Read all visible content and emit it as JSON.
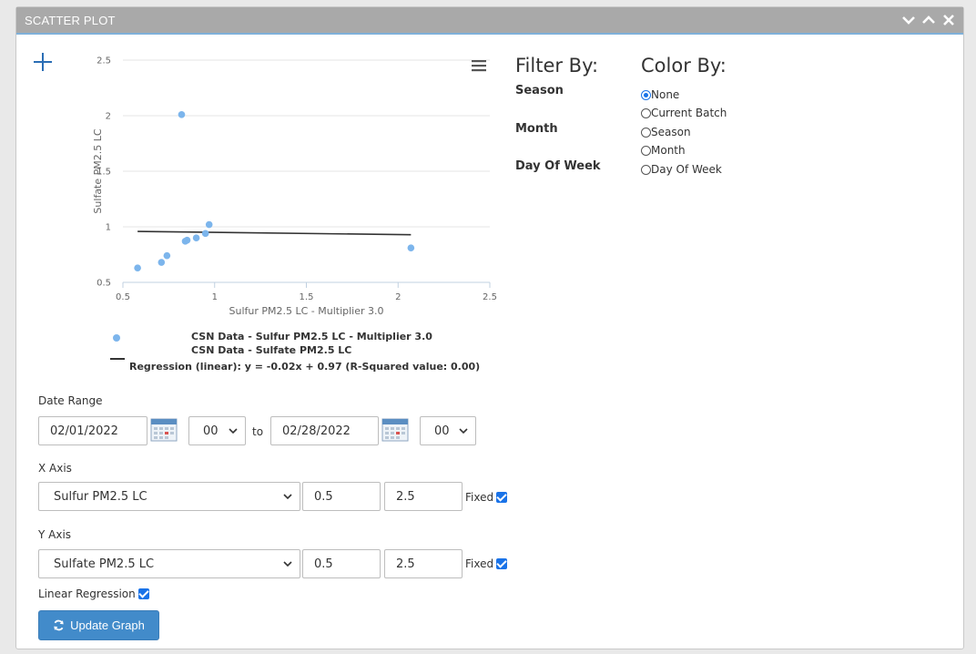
{
  "panel": {
    "title": "SCATTER PLOT"
  },
  "chart_data": {
    "type": "scatter",
    "xlabel": "Sulfur PM2.5 LC - Multiplier 3.0",
    "ylabel": "Sulfate PM2.5 LC",
    "xlim": [
      0.5,
      2.5
    ],
    "ylim": [
      0.5,
      2.5
    ],
    "xticks": [
      "0.5",
      "1",
      "1.5",
      "2",
      "2.5"
    ],
    "yticks": [
      "0.5",
      "1",
      "1.5",
      "2",
      "2.5"
    ],
    "grid": true,
    "series": [
      {
        "name": "CSN Data - Sulfur PM2.5 LC - Multiplier 3.0 / CSN Data - Sulfate PM2.5 LC",
        "color": "#7cb5ec",
        "points": [
          [
            0.58,
            0.63
          ],
          [
            0.71,
            0.68
          ],
          [
            0.74,
            0.74
          ],
          [
            0.82,
            2.01
          ],
          [
            0.84,
            0.87
          ],
          [
            0.85,
            0.88
          ],
          [
            0.9,
            0.9
          ],
          [
            0.95,
            0.94
          ],
          [
            0.97,
            1.02
          ],
          [
            2.07,
            0.81
          ]
        ]
      }
    ],
    "regression": {
      "type": "linear",
      "slope": -0.02,
      "intercept": 0.97,
      "x_range": [
        0.58,
        2.07
      ],
      "color": "#333333"
    },
    "legend": {
      "series_line1": "CSN Data - Sulfur PM2.5 LC - Multiplier 3.0",
      "series_line2": "CSN Data - Sulfate PM2.5 LC",
      "regression_label": "Regression (linear): y = -0.02x + 0.97 (R-Squared value: 0.00)",
      "placement": "bottom"
    }
  },
  "filter": {
    "title": "Filter By:",
    "items": [
      "Season",
      "Month",
      "Day Of Week"
    ]
  },
  "color_by": {
    "title": "Color By:",
    "options": [
      {
        "label": "None",
        "checked": true
      },
      {
        "label": "Current Batch",
        "checked": false
      },
      {
        "label": "Season",
        "checked": false
      },
      {
        "label": "Month",
        "checked": false
      },
      {
        "label": "Day Of Week",
        "checked": false
      }
    ]
  },
  "date_range": {
    "label": "Date Range",
    "start_date": "02/01/2022",
    "start_hour": "00",
    "to_label": "to",
    "end_date": "02/28/2022",
    "end_hour": "00"
  },
  "x_axis": {
    "label": "X Axis",
    "variable": "Sulfur PM2.5 LC",
    "min": "0.5",
    "max": "2.5",
    "fixed_label": "Fixed",
    "fixed": true
  },
  "y_axis": {
    "label": "Y Axis",
    "variable": "Sulfate PM2.5 LC",
    "min": "0.5",
    "max": "2.5",
    "fixed_label": "Fixed",
    "fixed": true
  },
  "linear_regression": {
    "label": "Linear Regression",
    "checked": true
  },
  "update_button": {
    "label": "Update Graph"
  }
}
